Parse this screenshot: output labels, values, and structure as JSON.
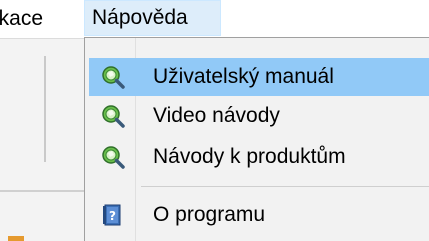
{
  "menubar": {
    "items": [
      {
        "label": "ikace"
      },
      {
        "label": "Nápověda"
      }
    ]
  },
  "dropdown": {
    "items": [
      {
        "label": "Uživatelský manuál",
        "icon": "magnifier-icon",
        "highlighted": true
      },
      {
        "label": "Video návody",
        "icon": "magnifier-icon",
        "highlighted": false
      },
      {
        "label": "Návody k produktům",
        "icon": "magnifier-icon",
        "highlighted": false
      },
      {
        "label": "O programu",
        "icon": "about-help-icon",
        "highlighted": false
      }
    ]
  },
  "colors": {
    "highlight": "#91c9f7",
    "menu_background": "#f2f2f2",
    "active_menubar": "#ddedfa"
  }
}
